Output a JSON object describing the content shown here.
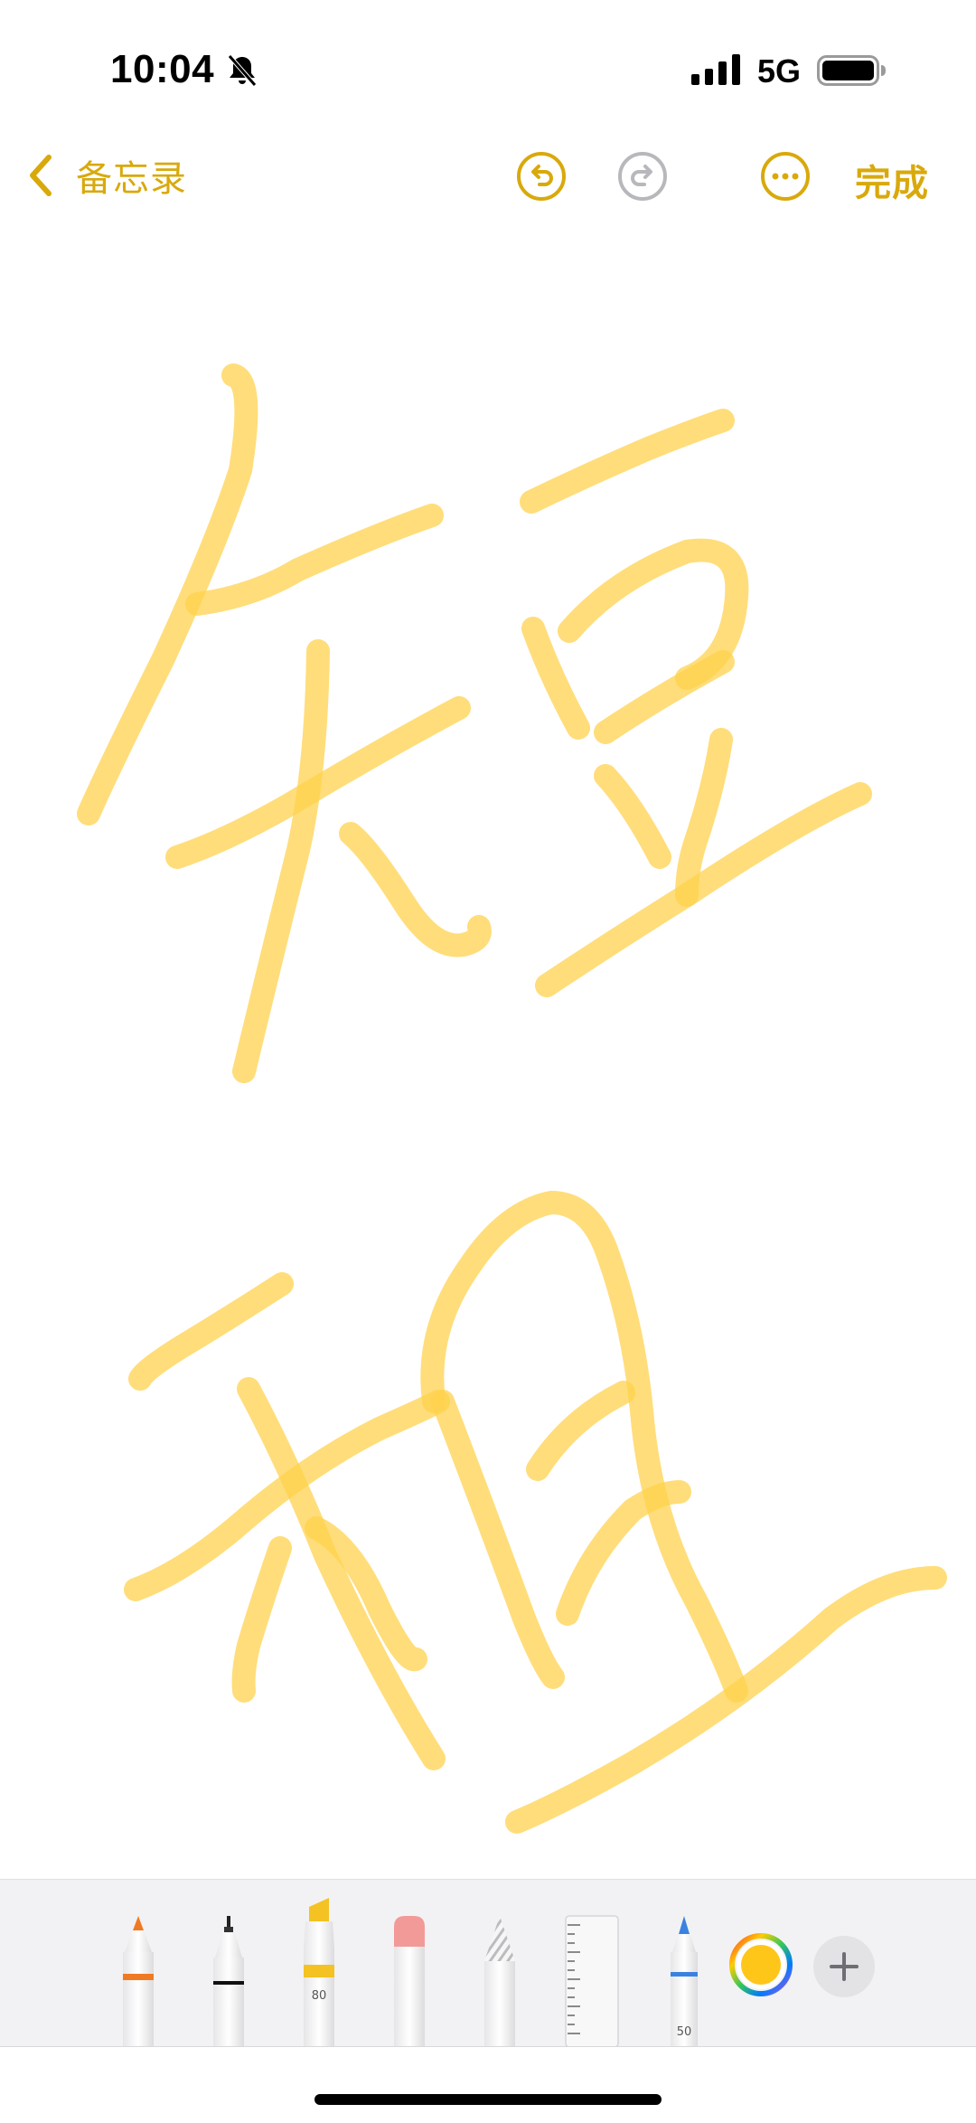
{
  "status_bar": {
    "time": "10:04",
    "network": "5G",
    "silent_icon": "bell-slash-icon"
  },
  "nav": {
    "back_label": "备忘录",
    "done_label": "完成",
    "undo_icon": "undo-icon",
    "redo_icon": "redo-icon",
    "more_icon": "more-icon"
  },
  "canvas": {
    "ink_color": "#ffd24d",
    "strokes_description_hidden": true
  },
  "toolbar": {
    "tools": [
      "pen",
      "fineliner",
      "marker",
      "eraser",
      "lasso",
      "ruler",
      "crayon"
    ],
    "marker_size": "80",
    "crayon_size": "50",
    "selected_color": "#ffc61a"
  },
  "colors": {
    "accent": "#d9a90c",
    "toolbar_bg": "#f2f2f4"
  }
}
